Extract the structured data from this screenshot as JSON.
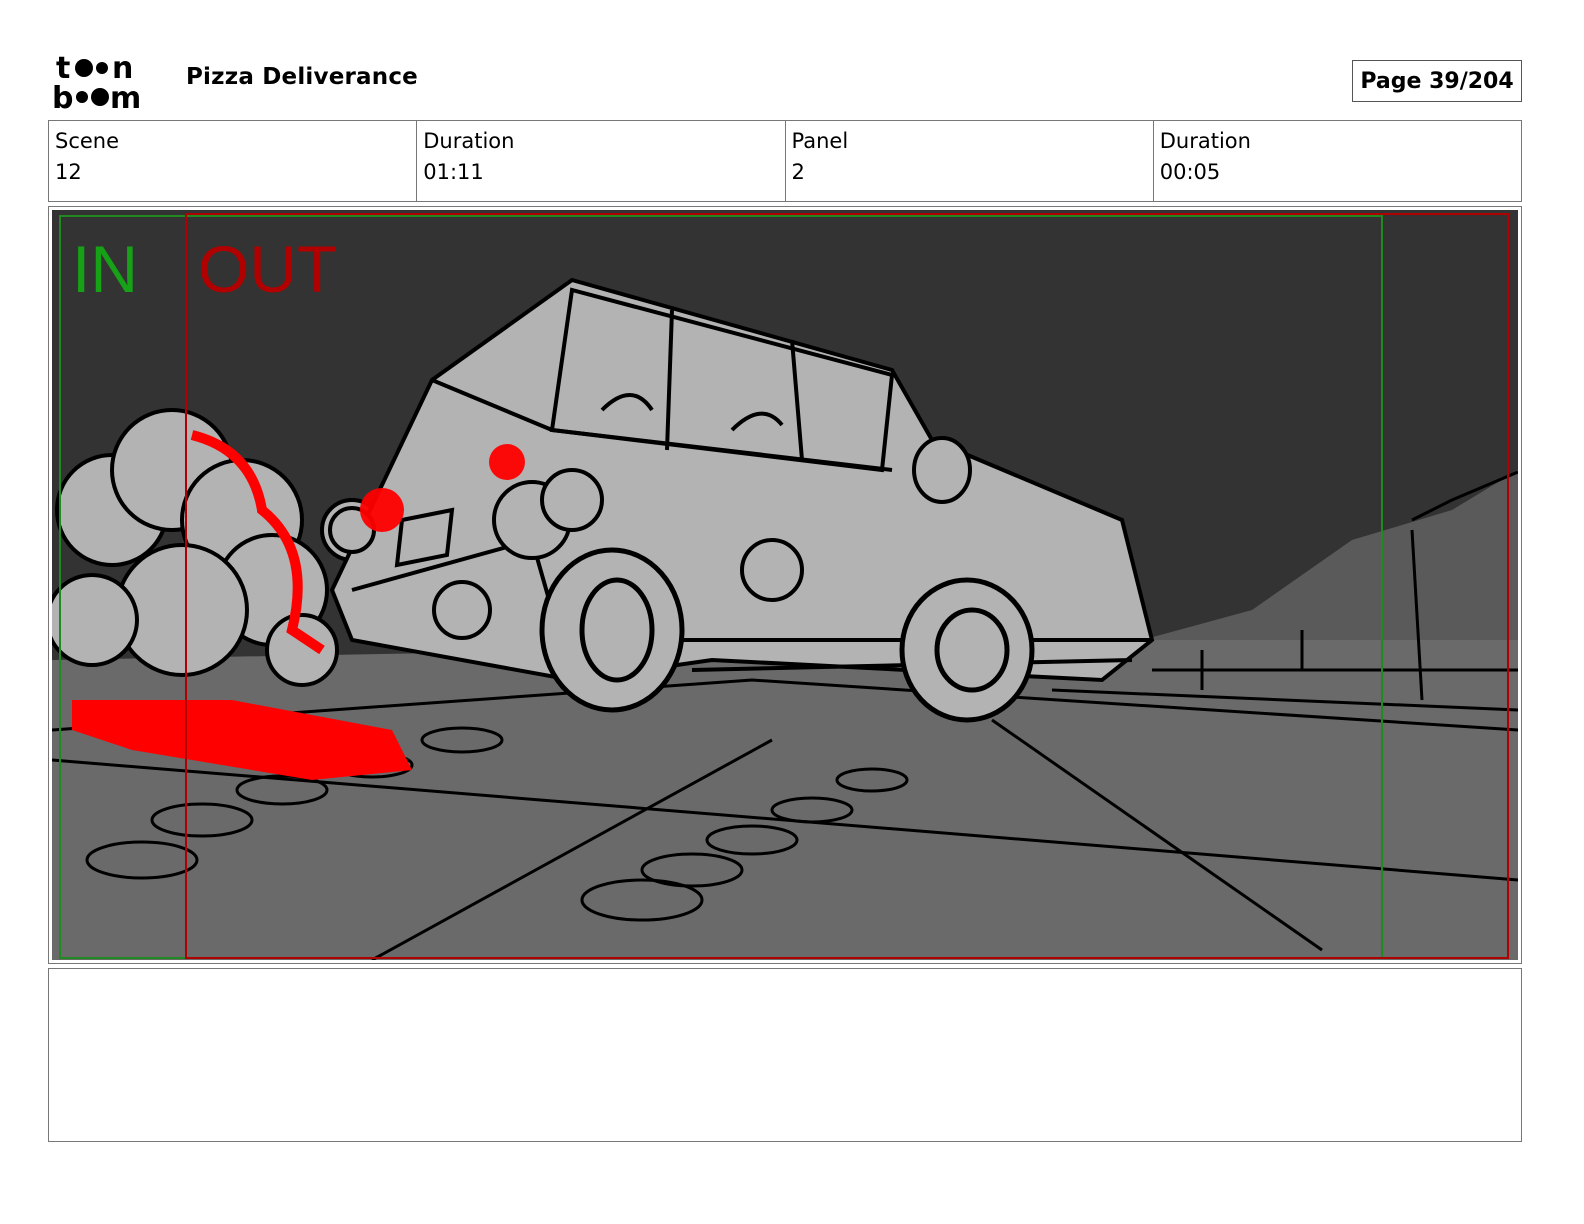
{
  "header": {
    "logo_text": "toon boom",
    "project_title": "Pizza Deliverance",
    "page_label": "Page",
    "page_number": "39/204"
  },
  "info": {
    "scene_label": "Scene",
    "scene_value": "12",
    "scene_duration_label": "Duration",
    "scene_duration_value": "01:11",
    "panel_label": "Panel",
    "panel_value": "2",
    "panel_duration_label": "Duration",
    "panel_duration_value": "00:05"
  },
  "panel": {
    "in_marker": "IN",
    "out_marker": "OUT",
    "colors": {
      "sky": "#333333",
      "ground": "#6a6a6a",
      "car": "#b3b3b3",
      "highlight_red": "#ff0000",
      "in_green": "#17a117",
      "out_red": "#b00000"
    }
  },
  "notes": {
    "text": ""
  }
}
